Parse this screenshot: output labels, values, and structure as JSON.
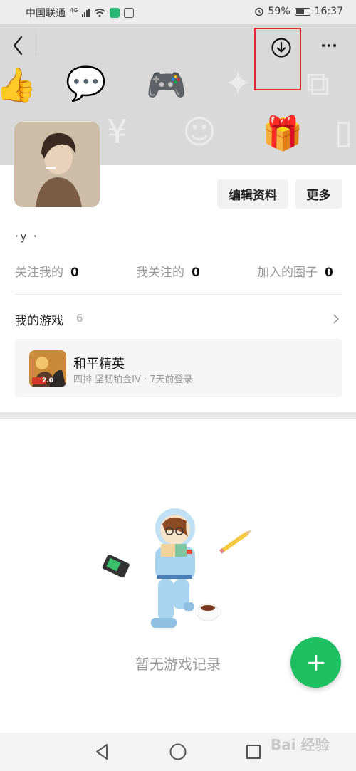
{
  "status_bar": {
    "carrier": "中国联通",
    "network": "4G",
    "battery": "59%",
    "time": "16:37"
  },
  "header": {
    "back_icon": "chevron-left-icon",
    "download_icon": "download-circle-icon",
    "more_icon": "ellipsis-icon",
    "highlight_color": "#e0282e"
  },
  "profile": {
    "nickname": "·y ·",
    "edit_label": "编辑资料",
    "more_label": "更多"
  },
  "stats": [
    {
      "label": "关注我的",
      "value": "0"
    },
    {
      "label": "我关注的",
      "value": "0"
    },
    {
      "label": "加入的圈子",
      "value": "0"
    }
  ],
  "games": {
    "title": "我的游戏",
    "count": "6",
    "items": [
      {
        "name": "和平精英",
        "detail": "四排 坚韧铂金IV · 7天前登录",
        "icon_badge": "2.0"
      }
    ]
  },
  "empty_state": {
    "text": "暂无游戏记录"
  },
  "fab": {
    "icon": "plus-icon",
    "color": "#1dbf60"
  },
  "watermark": "Bai 经验"
}
